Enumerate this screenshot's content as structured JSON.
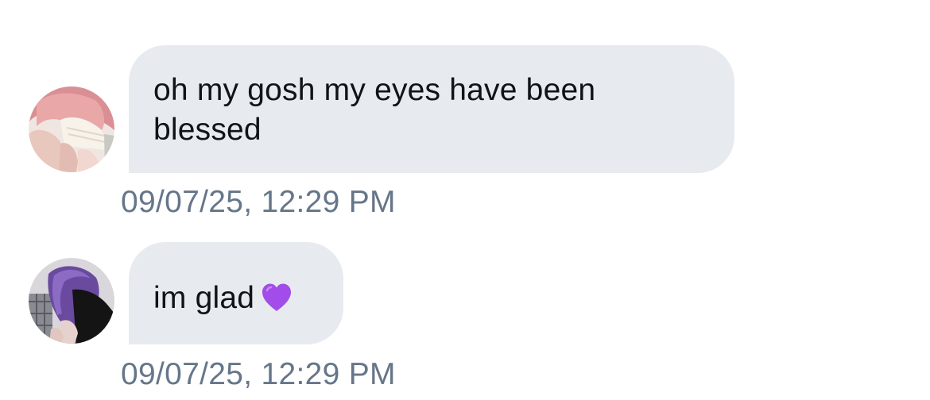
{
  "messages": [
    {
      "text": "oh my gosh my eyes have been blessed",
      "timestamp": "09/07/25, 12:29 PM",
      "avatar_icon": "pink-hair-avatar"
    },
    {
      "text": "im glad",
      "emoji": "purple-heart-icon",
      "timestamp": "09/07/25, 12:29 PM",
      "avatar_icon": "purple-hair-avatar"
    }
  ],
  "colors": {
    "bubble_bg": "#e7ebf0",
    "text": "#0f1419",
    "timestamp": "#66768a",
    "heart": "#a24dea"
  }
}
